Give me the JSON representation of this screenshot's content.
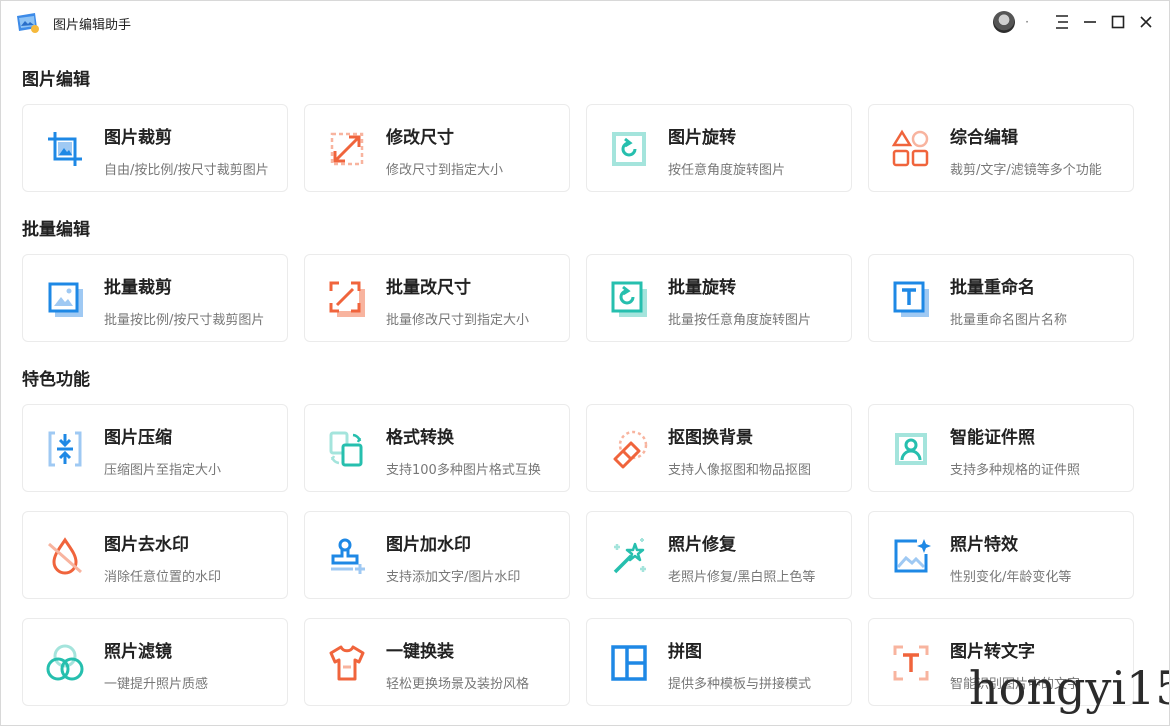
{
  "app": {
    "title": "图片编辑助手",
    "separator": "·"
  },
  "sections": [
    {
      "title": "图片编辑"
    },
    {
      "title": "批量编辑"
    },
    {
      "title": "特色功能"
    }
  ],
  "cards": [
    {
      "name": "图片裁剪",
      "desc": "自由/按比例/按尺寸裁剪图片",
      "icon": "crop-icon"
    },
    {
      "name": "修改尺寸",
      "desc": "修改尺寸到指定大小",
      "icon": "resize-icon"
    },
    {
      "name": "图片旋转",
      "desc": "按任意角度旋转图片",
      "icon": "rotate-icon"
    },
    {
      "name": "综合编辑",
      "desc": "裁剪/文字/滤镜等多个功能",
      "icon": "shapes-icon"
    },
    {
      "name": "批量裁剪",
      "desc": "批量按比例/按尺寸裁剪图片",
      "icon": "batch-crop-icon"
    },
    {
      "name": "批量改尺寸",
      "desc": "批量修改尺寸到指定大小",
      "icon": "batch-resize-icon"
    },
    {
      "name": "批量旋转",
      "desc": "批量按任意角度旋转图片",
      "icon": "batch-rotate-icon"
    },
    {
      "name": "批量重命名",
      "desc": "批量重命名图片名称",
      "icon": "rename-icon"
    },
    {
      "name": "图片压缩",
      "desc": "压缩图片至指定大小",
      "icon": "compress-icon"
    },
    {
      "name": "格式转换",
      "desc": "支持100多种图片格式互换",
      "icon": "convert-icon"
    },
    {
      "name": "抠图换背景",
      "desc": "支持人像抠图和物品抠图",
      "icon": "eraser-icon"
    },
    {
      "name": "智能证件照",
      "desc": "支持多种规格的证件照",
      "icon": "id-photo-icon"
    },
    {
      "name": "图片去水印",
      "desc": "消除任意位置的水印",
      "icon": "remove-watermark-icon"
    },
    {
      "name": "图片加水印",
      "desc": "支持添加文字/图片水印",
      "icon": "stamp-icon"
    },
    {
      "name": "照片修复",
      "desc": "老照片修复/黑白照上色等",
      "icon": "magic-wand-icon"
    },
    {
      "name": "照片特效",
      "desc": "性别变化/年龄变化等",
      "icon": "effect-icon"
    },
    {
      "name": "照片滤镜",
      "desc": "一键提升照片质感",
      "icon": "filter-icon"
    },
    {
      "name": "一键换装",
      "desc": "轻松更换场景及装扮风格",
      "icon": "shirt-icon"
    },
    {
      "name": "拼图",
      "desc": "提供多种模板与拼接模式",
      "icon": "collage-icon"
    },
    {
      "name": "图片转文字",
      "desc": "智能识别图片中的文字",
      "icon": "ocr-icon"
    }
  ],
  "watermark": "hongyi15",
  "colors": {
    "blue": "#1e88e5",
    "orange": "#f0643c",
    "teal": "#26bfae",
    "light_blue": "#9fc9f3",
    "light_orange": "#f8b49f",
    "light_teal": "#a4e4dc"
  }
}
